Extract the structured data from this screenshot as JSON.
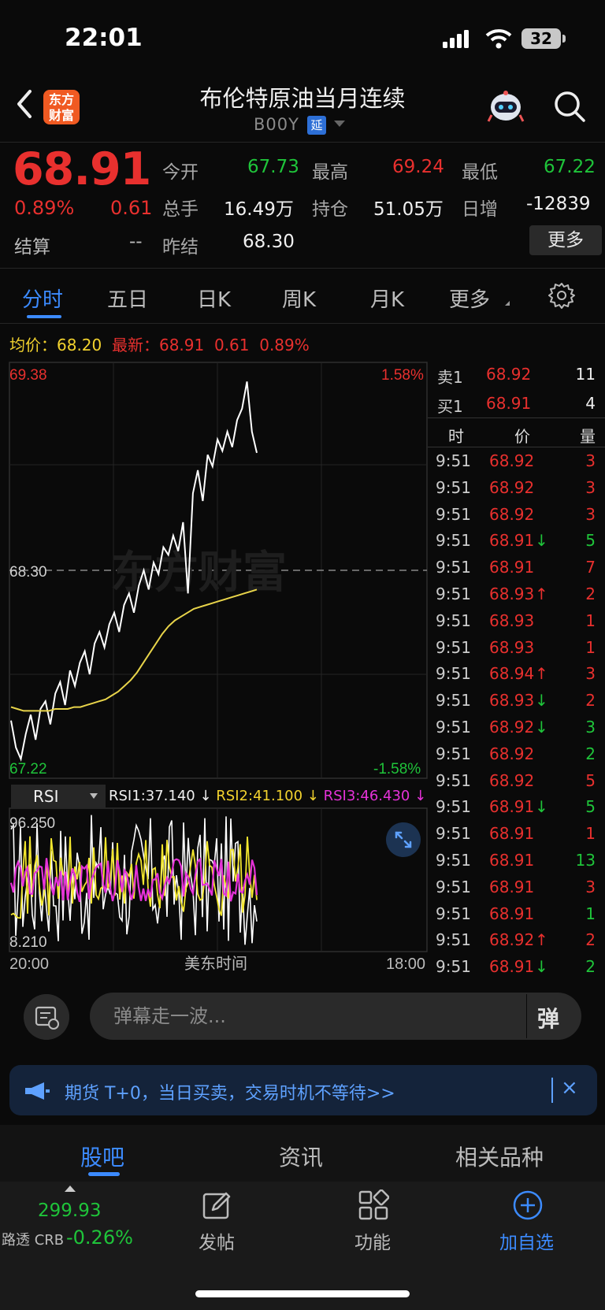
{
  "status_bar": {
    "time": "22:01",
    "battery": "32"
  },
  "header": {
    "logo_line1": "东方",
    "logo_line2": "财富",
    "title": "布伦特原油当月连续",
    "code": "B00Y",
    "delay_badge": "延"
  },
  "quote": {
    "price": "68.91",
    "change_pct": "0.89%",
    "change_abs": "0.61",
    "fields": {
      "open_label": "今开",
      "open": "67.73",
      "high_label": "最高",
      "high": "69.24",
      "low_label": "最低",
      "low": "67.22",
      "volume_label": "总手",
      "volume": "16.49万",
      "oi_label": "持仓",
      "oi": "51.05万",
      "oi_chg_label": "日增",
      "oi_chg": "-12839",
      "settle_label": "结算",
      "settle": "--",
      "prev_settle_label": "昨结",
      "prev_settle": "68.30"
    },
    "more_button": "更多"
  },
  "tabs": [
    "分时",
    "五日",
    "日K",
    "周K",
    "月K",
    "更多"
  ],
  "chart_header": {
    "avg_label": "均价：",
    "avg": "68.20",
    "latest_label": "最新：",
    "latest": "68.91",
    "latest_chg": "0.61",
    "latest_pct": "0.89%"
  },
  "chart_data": [
    {
      "type": "line",
      "watermark": "东方财富",
      "y_top_label": "69.38",
      "y_mid_label": "68.30",
      "y_bottom_label": "67.22",
      "pct_top_label": "1.58%",
      "pct_bottom_label": "-1.58%",
      "ylim": [
        67.22,
        69.38
      ],
      "x_labels": [
        "20:00",
        "美东时间",
        "18:00"
      ],
      "reference": 68.3,
      "series": [
        {
          "color": "#ffffff",
          "values": [
            67.52,
            67.38,
            67.32,
            67.45,
            67.55,
            67.42,
            67.58,
            67.62,
            67.5,
            67.66,
            67.72,
            67.6,
            67.78,
            67.7,
            67.82,
            67.88,
            67.76,
            67.92,
            67.98,
            67.9,
            68.02,
            68.08,
            67.98,
            68.12,
            68.18,
            68.08,
            68.22,
            68.3,
            68.2,
            68.34,
            68.28,
            68.42,
            68.38,
            68.48,
            68.4,
            68.55,
            68.18,
            68.7,
            68.82,
            68.66,
            68.9,
            68.84,
            68.98,
            68.92,
            69.02,
            68.94,
            69.08,
            69.14,
            69.28,
            69.02,
            68.91
          ]
        },
        {
          "color": "#e8d44a",
          "values": [
            67.59,
            67.58,
            67.57,
            67.57,
            67.57,
            67.57,
            67.57,
            67.58,
            67.58,
            67.58,
            67.59,
            67.59,
            67.6,
            67.61,
            67.62,
            67.63,
            67.65,
            67.67,
            67.7,
            67.73,
            67.77,
            67.82,
            67.87,
            67.92,
            67.97,
            68.01,
            68.04,
            68.06,
            68.08,
            68.1,
            68.11,
            68.12,
            68.13,
            68.14,
            68.15,
            68.16,
            68.17,
            68.18,
            68.19,
            68.2
          ]
        }
      ]
    },
    {
      "type": "line",
      "name": "RSI",
      "y_top_label": "96.250",
      "y_bottom_label": "8.210",
      "ylim": [
        8.21,
        96.25
      ],
      "series": [
        {
          "name": "RSI1",
          "value": "37.140",
          "color": "#ffffff"
        },
        {
          "name": "RSI2",
          "value": "41.100",
          "color": "#f2e62e"
        },
        {
          "name": "RSI3",
          "value": "46.430",
          "color": "#e532d8"
        }
      ]
    }
  ],
  "order_book": {
    "ask": {
      "label": "卖1",
      "price": "68.92",
      "vol": "11"
    },
    "bid": {
      "label": "买1",
      "price": "68.91",
      "vol": "4"
    },
    "headers": [
      "时",
      "价",
      "量"
    ],
    "trades": [
      {
        "t": "9:51",
        "p": "68.92",
        "a": "",
        "v": "3",
        "vc": "red"
      },
      {
        "t": "9:51",
        "p": "68.92",
        "a": "",
        "v": "3",
        "vc": "red"
      },
      {
        "t": "9:51",
        "p": "68.92",
        "a": "",
        "v": "3",
        "vc": "red"
      },
      {
        "t": "9:51",
        "p": "68.91",
        "a": "↓",
        "v": "5",
        "vc": "green"
      },
      {
        "t": "9:51",
        "p": "68.91",
        "a": "",
        "v": "7",
        "vc": "red"
      },
      {
        "t": "9:51",
        "p": "68.93",
        "a": "↑",
        "v": "2",
        "vc": "red"
      },
      {
        "t": "9:51",
        "p": "68.93",
        "a": "",
        "v": "1",
        "vc": "red"
      },
      {
        "t": "9:51",
        "p": "68.93",
        "a": "",
        "v": "1",
        "vc": "red"
      },
      {
        "t": "9:51",
        "p": "68.94",
        "a": "↑",
        "v": "3",
        "vc": "red"
      },
      {
        "t": "9:51",
        "p": "68.93",
        "a": "↓",
        "v": "2",
        "vc": "red"
      },
      {
        "t": "9:51",
        "p": "68.92",
        "a": "↓",
        "v": "3",
        "vc": "green"
      },
      {
        "t": "9:51",
        "p": "68.92",
        "a": "",
        "v": "2",
        "vc": "green"
      },
      {
        "t": "9:51",
        "p": "68.92",
        "a": "",
        "v": "5",
        "vc": "red"
      },
      {
        "t": "9:51",
        "p": "68.91",
        "a": "↓",
        "v": "5",
        "vc": "green"
      },
      {
        "t": "9:51",
        "p": "68.91",
        "a": "",
        "v": "1",
        "vc": "red"
      },
      {
        "t": "9:51",
        "p": "68.91",
        "a": "",
        "v": "13",
        "vc": "green"
      },
      {
        "t": "9:51",
        "p": "68.91",
        "a": "",
        "v": "3",
        "vc": "red"
      },
      {
        "t": "9:51",
        "p": "68.91",
        "a": "",
        "v": "1",
        "vc": "green"
      },
      {
        "t": "9:51",
        "p": "68.92",
        "a": "↑",
        "v": "2",
        "vc": "red"
      },
      {
        "t": "9:51",
        "p": "68.91",
        "a": "↓",
        "v": "2",
        "vc": "green"
      }
    ]
  },
  "danmu": {
    "placeholder": "弹幕走一波...",
    "send": "弹"
  },
  "banner": {
    "text": "期货 T+0，当日买卖，交易时机不等待>>",
    "close": "×"
  },
  "bottom_tabs": [
    "股吧",
    "资讯",
    "相关品种"
  ],
  "bottom_bar": {
    "crb_value": "299.93",
    "crb_label": "路透 CRB",
    "crb_pct": "-0.26%",
    "post": "发帖",
    "func": "功能",
    "add": "加自选"
  }
}
